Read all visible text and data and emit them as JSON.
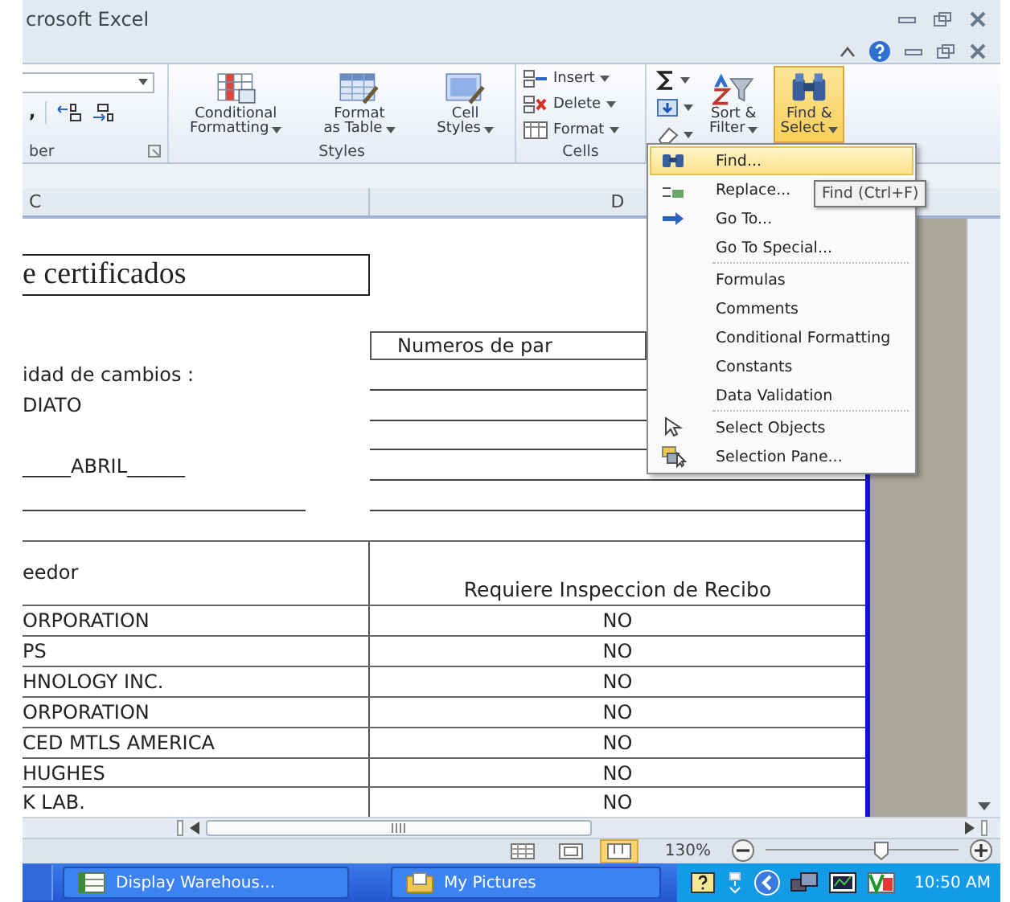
{
  "window": {
    "title": "crosoft Excel"
  },
  "ribbon": {
    "number_group": {
      "label": "ber",
      "comma": ","
    },
    "styles_group": {
      "label": "Styles",
      "buttons": [
        {
          "label": [
            "Conditional",
            "Formatting"
          ]
        },
        {
          "label": [
            "Format",
            "as Table"
          ]
        },
        {
          "label": [
            "Cell",
            "Styles"
          ]
        }
      ]
    },
    "cells_group": {
      "label": "Cells",
      "buttons": [
        "Insert",
        "Delete",
        "Format"
      ]
    },
    "editing_group": {
      "buttons": [
        {
          "label": [
            "Sort &",
            "Filter"
          ],
          "selected": false
        },
        {
          "label": [
            "Find &",
            "Select"
          ],
          "selected": true
        }
      ]
    }
  },
  "columns": [
    "C",
    "D"
  ],
  "sheet": {
    "title": "e certificados",
    "parts_header": "Numeros de par",
    "lines": [
      "idad de cambios :",
      "DIATO",
      "_____ABRIL______"
    ],
    "table": {
      "columns": [
        "eedor",
        "Requiere Inspeccion de Recibo"
      ],
      "rows": [
        [
          "ORPORATION",
          "NO"
        ],
        [
          "PS",
          "NO"
        ],
        [
          "HNOLOGY INC.",
          "NO"
        ],
        [
          "ORPORATION",
          "NO"
        ],
        [
          "CED MTLS AMERICA",
          "NO"
        ],
        [
          "HUGHES",
          "NO"
        ],
        [
          "K LAB.",
          "NO"
        ]
      ]
    }
  },
  "menu": {
    "sections": [
      [
        {
          "label": "Find...",
          "selected": true
        },
        {
          "label": "Replace...",
          "selected": false
        },
        {
          "label": "Go To...",
          "selected": false
        },
        {
          "label": "Go To Special...",
          "selected": false
        }
      ],
      [
        {
          "label": "Formulas",
          "selected": false
        },
        {
          "label": "Comments",
          "selected": false
        },
        {
          "label": "Conditional Formatting",
          "selected": false
        },
        {
          "label": "Constants",
          "selected": false
        },
        {
          "label": "Data Validation",
          "selected": false
        }
      ],
      [
        {
          "label": "Select Objects",
          "selected": false
        },
        {
          "label": "Selection Pane...",
          "selected": false
        }
      ]
    ]
  },
  "tooltip": "Find (Ctrl+F)",
  "status_bar": {
    "views": [
      {
        "selected": false
      },
      {
        "selected": false
      },
      {
        "selected": true
      }
    ],
    "zoom": "130%",
    "level": 0.6
  },
  "taskbar": {
    "buttons": [
      "Display Warehous...",
      "My Pictures"
    ],
    "clock": "10:50 AM"
  }
}
